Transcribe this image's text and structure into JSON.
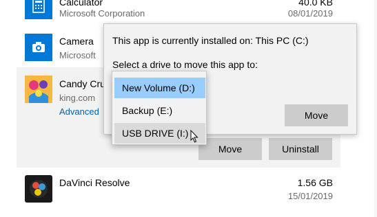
{
  "apps": {
    "calculator": {
      "name": "Calculator",
      "publisher": "Microsoft Corporation",
      "size": "40.0 KB",
      "date": "08/01/2019"
    },
    "camera": {
      "name": "Camera",
      "publisher": "Microsoft"
    },
    "candy": {
      "name": "Candy Cru",
      "publisher": "king.com",
      "advanced": "Advanced"
    },
    "davinci": {
      "name": "DaVinci Resolve",
      "size": "1.56 GB",
      "date": "15/01/2019"
    }
  },
  "buttons": {
    "move": "Move",
    "uninstall": "Uninstall"
  },
  "flyout": {
    "installed_text": "This app is currently installed on: This PC (C:)",
    "select_text": "Select a drive to move this app to:",
    "move_label": "Move"
  },
  "drives": [
    "New Volume (D:)",
    "Backup (E:)",
    "USB DRIVE (I:)"
  ],
  "colors": {
    "accent": "#0078d7",
    "selected": "#99ccff",
    "button": "#cccccc"
  }
}
